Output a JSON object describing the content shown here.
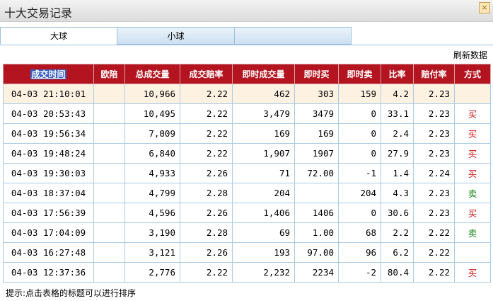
{
  "window": {
    "title": "十大交易记录",
    "close_icon": "close-icon"
  },
  "tabs": [
    {
      "label": "大球",
      "active": true
    },
    {
      "label": "小球",
      "active": false
    },
    {
      "label": "",
      "active": false
    }
  ],
  "refresh_label": "刷新数据",
  "table": {
    "headers": [
      "成交时间",
      "欧陪",
      "总成交量",
      "成交赔率",
      "即时成交量",
      "即时买",
      "即时卖",
      "比率",
      "赔付率",
      "方式"
    ],
    "rows": [
      [
        "04-03 21:10:01",
        "",
        "10,966",
        "2.22",
        "462",
        "303",
        "159",
        "4.2",
        "2.23",
        ""
      ],
      [
        "04-03 20:53:43",
        "",
        "10,495",
        "2.22",
        "3,479",
        "3479",
        "0",
        "33.1",
        "2.23",
        "买"
      ],
      [
        "04-03 19:56:34",
        "",
        "7,009",
        "2.22",
        "169",
        "169",
        "0",
        "2.4",
        "2.23",
        "买"
      ],
      [
        "04-03 19:48:24",
        "",
        "6,840",
        "2.22",
        "1,907",
        "1907",
        "0",
        "27.9",
        "2.23",
        "买"
      ],
      [
        "04-03 19:30:03",
        "",
        "4,933",
        "2.26",
        "71",
        "72.00",
        "-1",
        "1.4",
        "2.24",
        "买"
      ],
      [
        "04-03 18:37:04",
        "",
        "4,799",
        "2.28",
        "204",
        "",
        "204",
        "4.3",
        "2.23",
        "卖"
      ],
      [
        "04-03 17:56:39",
        "",
        "4,596",
        "2.26",
        "1,406",
        "1406",
        "0",
        "30.6",
        "2.23",
        "买"
      ],
      [
        "04-03 17:04:09",
        "",
        "3,190",
        "2.28",
        "69",
        "1.00",
        "68",
        "2.2",
        "2.22",
        "卖"
      ],
      [
        "04-03 16:27:48",
        "",
        "3,121",
        "2.26",
        "193",
        "97.00",
        "96",
        "6.2",
        "2.22",
        ""
      ],
      [
        "04-03 12:37:36",
        "",
        "2,776",
        "2.22",
        "2,232",
        "2234",
        "-2",
        "80.4",
        "2.22",
        "买"
      ]
    ]
  },
  "hint": "提示:点击表格的标题可以进行排序",
  "colors": {
    "header_bg": "#b3141f",
    "buy": "#d01a1a",
    "sell": "#1a8a1a"
  }
}
